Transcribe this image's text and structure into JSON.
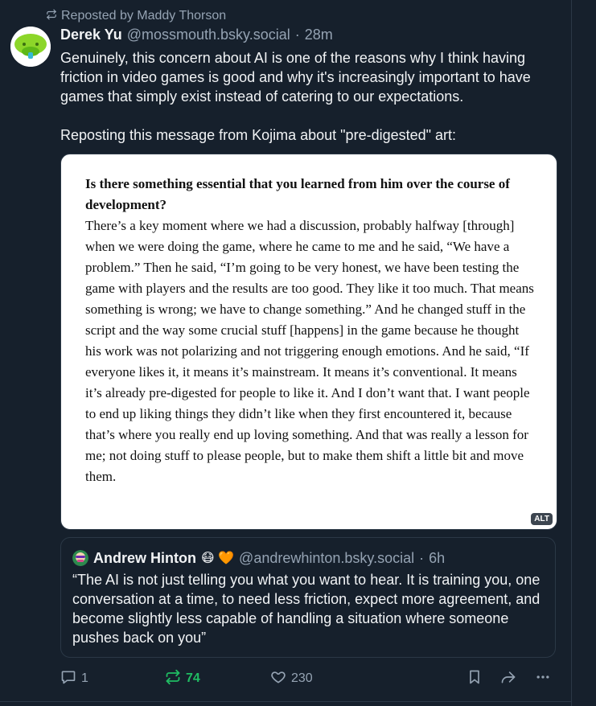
{
  "repost_context": {
    "label": "Reposted by Maddy Thorson"
  },
  "post": {
    "author_name": "Derek Yu",
    "author_handle": "@mossmouth.bsky.social",
    "separator": "·",
    "time": "28m",
    "text_paragraphs": [
      "Genuinely, this concern about AI is one of the reasons why I think having friction in video games is good and why it's increasingly important to have games that simply exist instead of catering to our expectations.",
      "Reposting this message from Kojima about \"pre-digested\" art:"
    ]
  },
  "embedded_image": {
    "question": "Is there something essential that you learned from him over the course of development?",
    "answer": "There’s a key moment where we had a discussion, probably halfway [through] when we were doing the game, where he came to me and he said, “We have a problem.” Then he said, “I’m going to be very honest, we have been testing the game with players and the results are too good. They like it too much. That means something is wrong; we have to change something.” And he changed stuff in the script and the way some crucial stuff [happens] in the game because he thought his work was not polarizing and not triggering enough emotions. And he said, “If everyone likes it, it means it’s mainstream. It means it’s conventional. It means it’s already pre-digested for people to like it. And I don’t want that. I want people to end up liking things they didn’t like when they first encountered it, because that’s where you really end up loving something. And that was really a lesson for me; not doing stuff to please people, but to make them shift a little bit and move them.",
    "alt_badge": "ALT"
  },
  "quoted_post": {
    "author_name": "Andrew Hinton",
    "emoji": "😷 🧡",
    "author_handle": "@andrewhinton.bsky.social",
    "separator": "·",
    "time": "6h",
    "text": "“The AI is not just telling you what you want to hear. It is training you, one conversation at a time, to need less friction, expect more agreement, and become slightly less capable of handling a situation where someone pushes back on you”"
  },
  "actions": {
    "reply_count": "1",
    "repost_count": "74",
    "like_count": "230"
  },
  "colors": {
    "background": "#16202c",
    "muted_text": "#95a3b3",
    "repost_active": "#20bc63",
    "border": "#2b3846"
  },
  "icons": [
    "repost-icon",
    "reply-icon",
    "like-icon",
    "bookmark-icon",
    "share-icon",
    "more-icon"
  ]
}
